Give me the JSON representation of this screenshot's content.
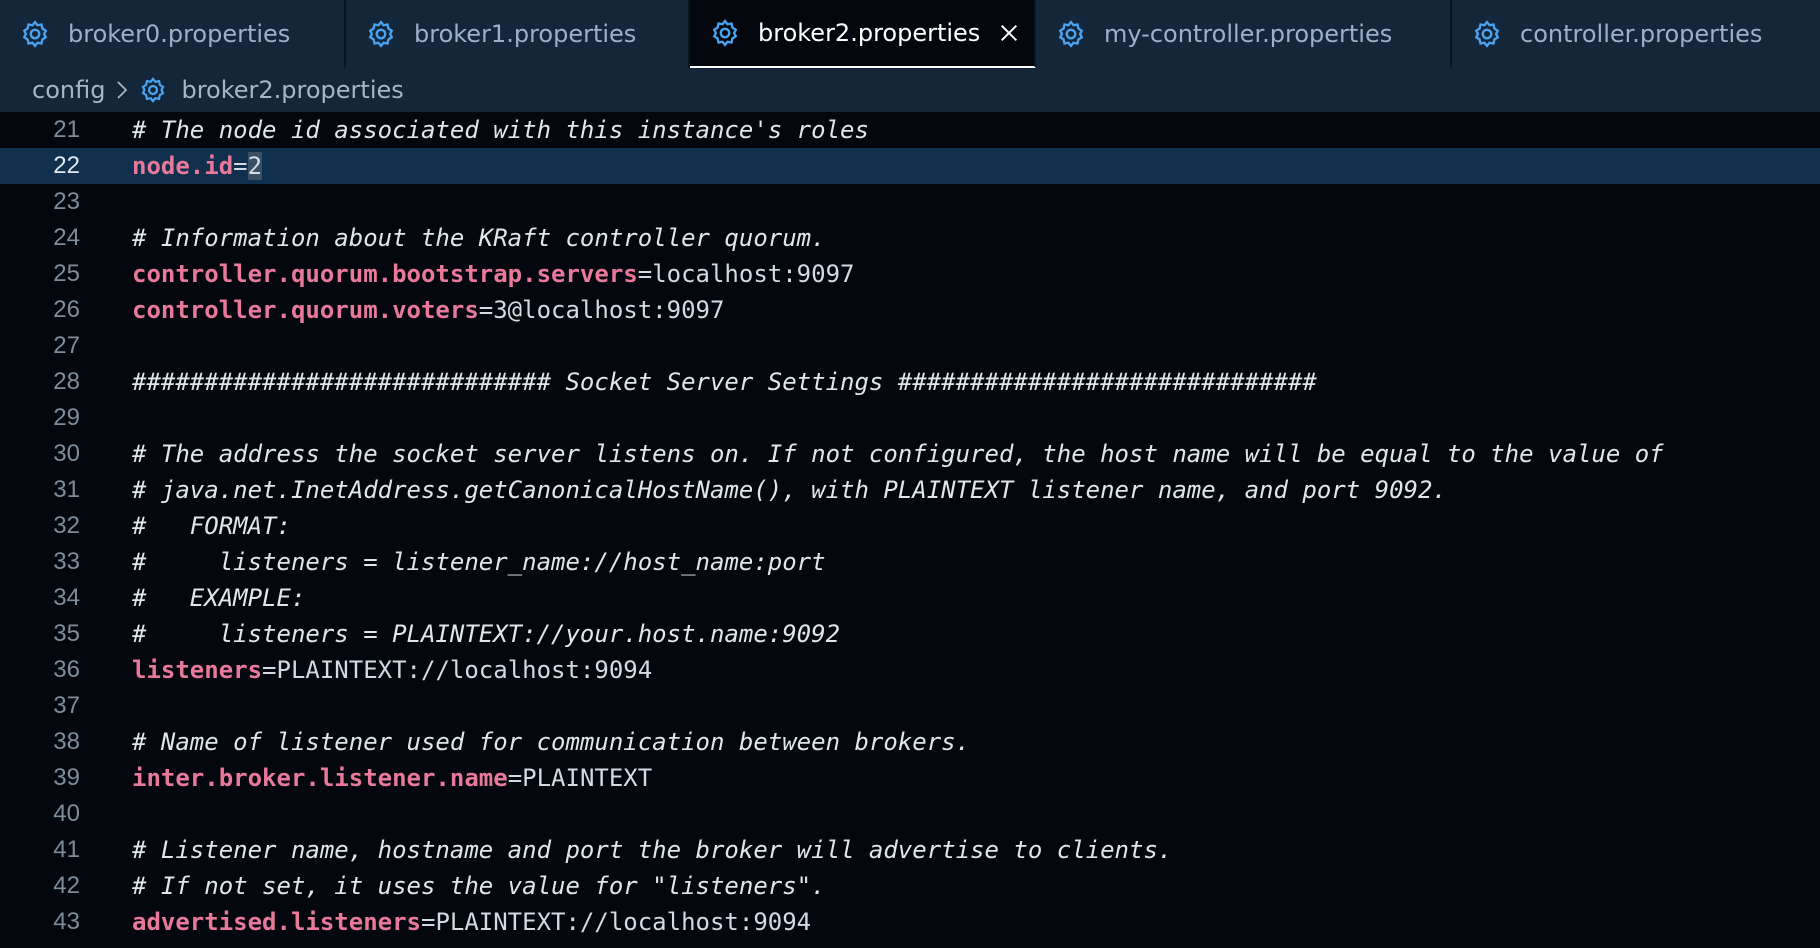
{
  "tabs": [
    {
      "label": "broker0.properties"
    },
    {
      "label": "broker1.properties"
    },
    {
      "label": "broker2.properties"
    },
    {
      "label": "my-controller.properties"
    },
    {
      "label": "controller.properties"
    }
  ],
  "breadcrumb": {
    "folder": "config",
    "file": "broker2.properties"
  },
  "editor": {
    "lines": [
      {
        "num": "21",
        "comment": "# The node id associated with this instance's roles"
      },
      {
        "num": "22",
        "key": "node.id",
        "eq": "=",
        "value": "2"
      },
      {
        "num": "23"
      },
      {
        "num": "24",
        "comment": "# Information about the KRaft controller quorum."
      },
      {
        "num": "25",
        "key": "controller.quorum.bootstrap.servers",
        "eq": "=",
        "value": "localhost:9097"
      },
      {
        "num": "26",
        "key": "controller.quorum.voters",
        "eq": "=",
        "value": "3@localhost:9097"
      },
      {
        "num": "27"
      },
      {
        "num": "28",
        "comment": "############################# Socket Server Settings #############################"
      },
      {
        "num": "29"
      },
      {
        "num": "30",
        "comment": "# The address the socket server listens on. If not configured, the host name will be equal to the value of"
      },
      {
        "num": "31",
        "comment": "# java.net.InetAddress.getCanonicalHostName(), with PLAINTEXT listener name, and port 9092."
      },
      {
        "num": "32",
        "comment": "#   FORMAT:"
      },
      {
        "num": "33",
        "comment": "#     listeners = listener_name://host_name:port"
      },
      {
        "num": "34",
        "comment": "#   EXAMPLE:"
      },
      {
        "num": "35",
        "comment": "#     listeners = PLAINTEXT://your.host.name:9092"
      },
      {
        "num": "36",
        "key": "listeners",
        "eq": "=",
        "value": "PLAINTEXT://localhost:9094"
      },
      {
        "num": "37"
      },
      {
        "num": "38",
        "comment": "# Name of listener used for communication between brokers."
      },
      {
        "num": "39",
        "key": "inter.broker.listener.name",
        "eq": "=",
        "value": "PLAINTEXT"
      },
      {
        "num": "40"
      },
      {
        "num": "41",
        "comment": "# Listener name, hostname and port the broker will advertise to clients."
      },
      {
        "num": "42",
        "comment": "# If not set, it uses the value for \"listeners\"."
      },
      {
        "num": "43",
        "key": "advertised.listeners",
        "eq": "=",
        "value": "PLAINTEXT://localhost:9094"
      }
    ]
  },
  "colors": {
    "key": "#e8799b",
    "gear_icon": "#4aa3f0",
    "active_line": "#10304e"
  }
}
